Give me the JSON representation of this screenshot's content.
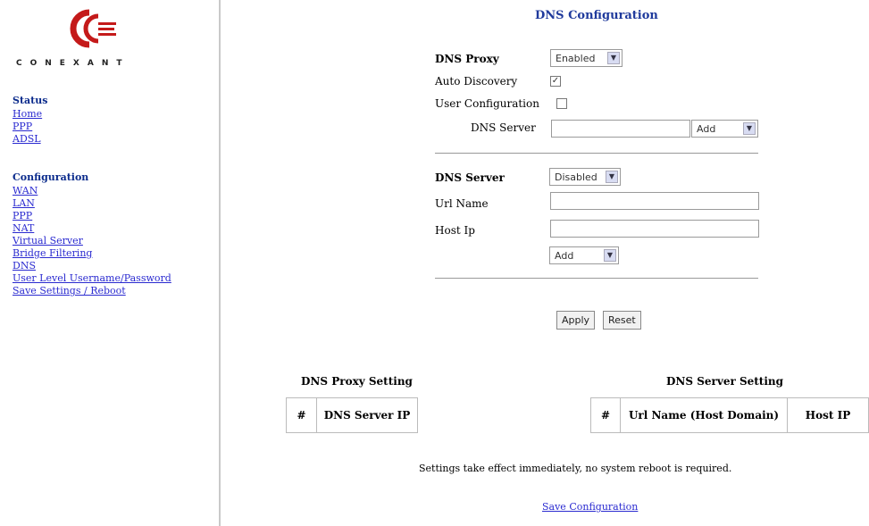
{
  "sidebar": {
    "brand": "CONEXANT",
    "status_heading": "Status",
    "status_links": [
      "Home",
      "PPP",
      "ADSL"
    ],
    "config_heading": "Configuration",
    "config_links": [
      "WAN",
      "LAN",
      "PPP",
      "NAT",
      "Virtual Server",
      "Bridge Filtering",
      "DNS",
      "User Level Username/Password",
      "Save Settings / Reboot"
    ]
  },
  "page": {
    "title": "DNS Configuration"
  },
  "proxy": {
    "label": "DNS Proxy",
    "value": "Enabled",
    "auto_discovery_label": "Auto Discovery",
    "auto_discovery_checked": true,
    "user_config_label": "User Configuration",
    "user_config_checked": false,
    "dns_server_label": "DNS Server",
    "dns_server_value": "",
    "action_value": "Add"
  },
  "server": {
    "label": "DNS Server",
    "value": "Disabled",
    "url_name_label": "Url Name",
    "url_name_value": "",
    "host_ip_label": "Host Ip",
    "host_ip_value": "",
    "action_value": "Add"
  },
  "buttons": {
    "apply": "Apply",
    "reset": "Reset"
  },
  "proxy_table": {
    "title": "DNS Proxy Setting",
    "columns": [
      "#",
      "DNS Server IP"
    ]
  },
  "server_table": {
    "title": "DNS Server Setting",
    "columns": [
      "#",
      "Url Name (Host Domain)",
      "Host IP"
    ]
  },
  "note": "Settings take effect immediately, no system reboot is required.",
  "save_link": "Save Configuration",
  "icons": {
    "dropdown": "chevron-down-icon",
    "check": "checkmark-icon"
  }
}
